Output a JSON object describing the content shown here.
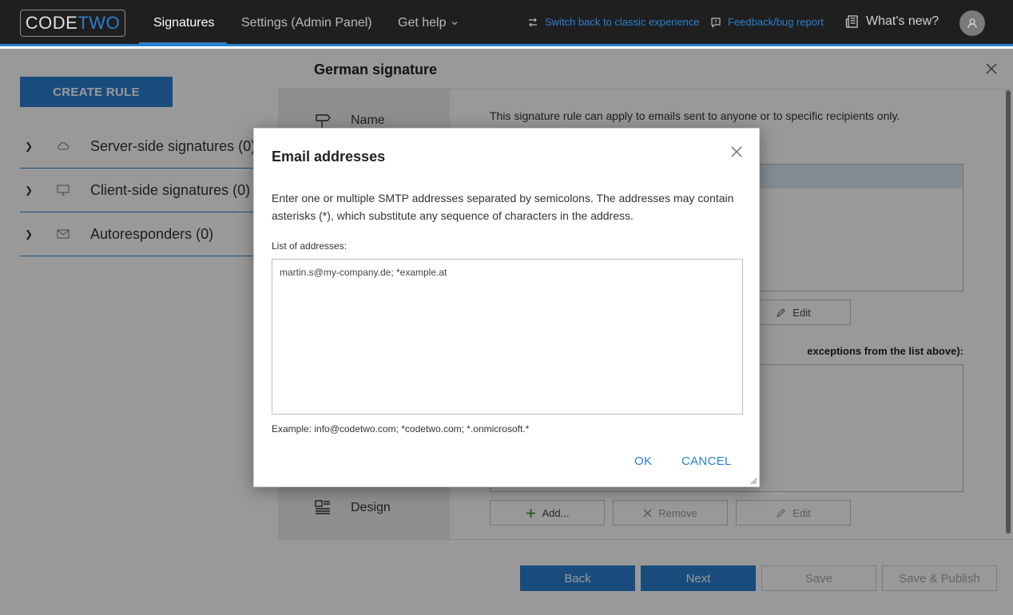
{
  "topbar": {
    "logo_part1": "CODE",
    "logo_part2": "TWO",
    "nav": [
      "Signatures",
      "Settings (Admin Panel)",
      "Get help"
    ],
    "switch_link": "Switch back to classic experience",
    "feedback_link": "Feedback/bug report",
    "whats_new": "What's new?"
  },
  "sidebar": {
    "create_rule": "CREATE RULE",
    "items": [
      {
        "label": "Server-side signatures (0)"
      },
      {
        "label": "Client-side signatures (0)"
      },
      {
        "label": "Autoresponders (0)"
      }
    ]
  },
  "drawer": {
    "title": "German signature",
    "steps": [
      {
        "label": "Name"
      },
      {
        "label": "Design"
      }
    ],
    "intro": "This signature rule can apply to emails sent to anyone or to specific recipients only.",
    "exceptions_label": "exceptions from the list above):",
    "buttons": {
      "edit": "Edit",
      "add": "Add...",
      "remove": "Remove"
    },
    "footer": {
      "back": "Back",
      "next": "Next",
      "save": "Save",
      "save_publish": "Save & Publish"
    }
  },
  "modal": {
    "title": "Email addresses",
    "description": "Enter one or multiple SMTP addresses separated by semicolons. The addresses may contain asterisks (*), which substitute any sequence of characters in the address.",
    "list_label": "List of addresses:",
    "addresses_value": "martin.s@my-company.de; *example.at",
    "example": "Example: info@codetwo.com; *codetwo.com; *.onmicrosoft.*",
    "ok": "OK",
    "cancel": "CANCEL"
  },
  "colors": {
    "accent": "#2b7fd0",
    "topbar_bg": "#1f1f1f"
  }
}
